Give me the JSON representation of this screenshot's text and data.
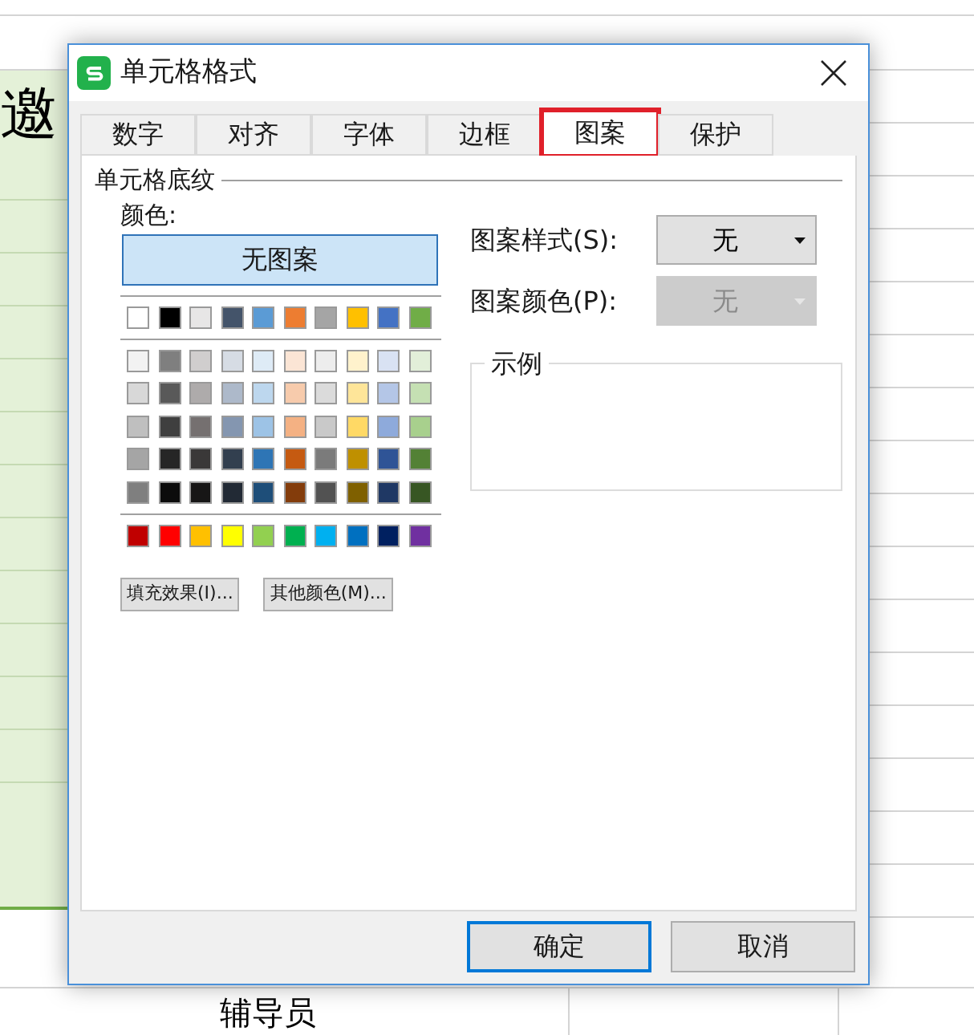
{
  "sheet": {
    "cells": [
      {
        "text": "邀",
        "kind": "large"
      },
      {
        "text": "辅导员",
        "kind": "normal"
      }
    ]
  },
  "dialog": {
    "title": "单元格格式",
    "tabs": [
      {
        "label": "数字",
        "selected": false,
        "highlighted": false
      },
      {
        "label": "对齐",
        "selected": false,
        "highlighted": false
      },
      {
        "label": "字体",
        "selected": false,
        "highlighted": false
      },
      {
        "label": "边框",
        "selected": false,
        "highlighted": false
      },
      {
        "label": "图案",
        "selected": true,
        "highlighted": true
      },
      {
        "label": "保护",
        "selected": false,
        "highlighted": false
      }
    ],
    "shading": {
      "group_label": "单元格底纹",
      "color_label": "颜色:",
      "no_pattern": {
        "label": "无图案",
        "selected": true
      },
      "palette_rows": [
        [
          {
            "color": "#ffffff"
          },
          {
            "color": "#000000"
          },
          {
            "color": "#e7e6e6"
          },
          {
            "color": "#44546a"
          },
          {
            "color": "#5b9bd5"
          },
          {
            "color": "#ed7d31"
          },
          {
            "color": "#a5a5a5"
          },
          {
            "color": "#ffc000"
          },
          {
            "color": "#4472c4"
          },
          {
            "color": "#70ad47"
          }
        ],
        [
          {
            "color": "#f2f2f2"
          },
          {
            "color": "#7f7f7f"
          },
          {
            "color": "#d0cece"
          },
          {
            "color": "#d6dce4"
          },
          {
            "color": "#deebf6"
          },
          {
            "color": "#fbe5d5"
          },
          {
            "color": "#ededed"
          },
          {
            "color": "#fff2cc"
          },
          {
            "color": "#d9e2f3"
          },
          {
            "color": "#e2efd9"
          }
        ],
        [
          {
            "color": "#d8d8d8"
          },
          {
            "color": "#595959"
          },
          {
            "color": "#aeabab"
          },
          {
            "color": "#adb9ca"
          },
          {
            "color": "#bdd7ee"
          },
          {
            "color": "#f7cbac"
          },
          {
            "color": "#dbdbdb"
          },
          {
            "color": "#fee599"
          },
          {
            "color": "#b4c6e7"
          },
          {
            "color": "#c5e0b3"
          }
        ],
        [
          {
            "color": "#bfbfbf"
          },
          {
            "color": "#3f3f3f"
          },
          {
            "color": "#757070"
          },
          {
            "color": "#8496b0"
          },
          {
            "color": "#9dc3e6"
          },
          {
            "color": "#f4b183"
          },
          {
            "color": "#c9c9c9"
          },
          {
            "color": "#ffd965"
          },
          {
            "color": "#8eaadb"
          },
          {
            "color": "#a8d08d"
          }
        ],
        [
          {
            "color": "#a5a5a5"
          },
          {
            "color": "#262626"
          },
          {
            "color": "#3a3838"
          },
          {
            "color": "#323f4f"
          },
          {
            "color": "#2e75b5"
          },
          {
            "color": "#c55a11"
          },
          {
            "color": "#7b7b7b"
          },
          {
            "color": "#bf9000"
          },
          {
            "color": "#2f5496"
          },
          {
            "color": "#538135"
          }
        ],
        [
          {
            "color": "#7f7f7f"
          },
          {
            "color": "#0c0c0c"
          },
          {
            "color": "#171616"
          },
          {
            "color": "#222a35"
          },
          {
            "color": "#1e4e79"
          },
          {
            "color": "#833c0b"
          },
          {
            "color": "#525252"
          },
          {
            "color": "#7f6000"
          },
          {
            "color": "#1f3864"
          },
          {
            "color": "#375623"
          }
        ],
        [
          {
            "color": "#c00000"
          },
          {
            "color": "#ff0000"
          },
          {
            "color": "#ffc000"
          },
          {
            "color": "#ffff00"
          },
          {
            "color": "#92d050"
          },
          {
            "color": "#00b050"
          },
          {
            "color": "#00b0f0"
          },
          {
            "color": "#0070c0"
          },
          {
            "color": "#002060"
          },
          {
            "color": "#7030a0"
          }
        ]
      ],
      "buttons": [
        "填充效果(I)...",
        "其他颜色(M)..."
      ]
    },
    "pattern_fields": [
      {
        "label": "图案样式(S):",
        "value": "无",
        "disabled": false
      },
      {
        "label": "图案颜色(P):",
        "value": "无",
        "disabled": true
      }
    ],
    "sample": {
      "label": "示例"
    },
    "buttons": [
      {
        "label": "确定",
        "default": true
      },
      {
        "label": "取消",
        "default": false
      }
    ]
  }
}
